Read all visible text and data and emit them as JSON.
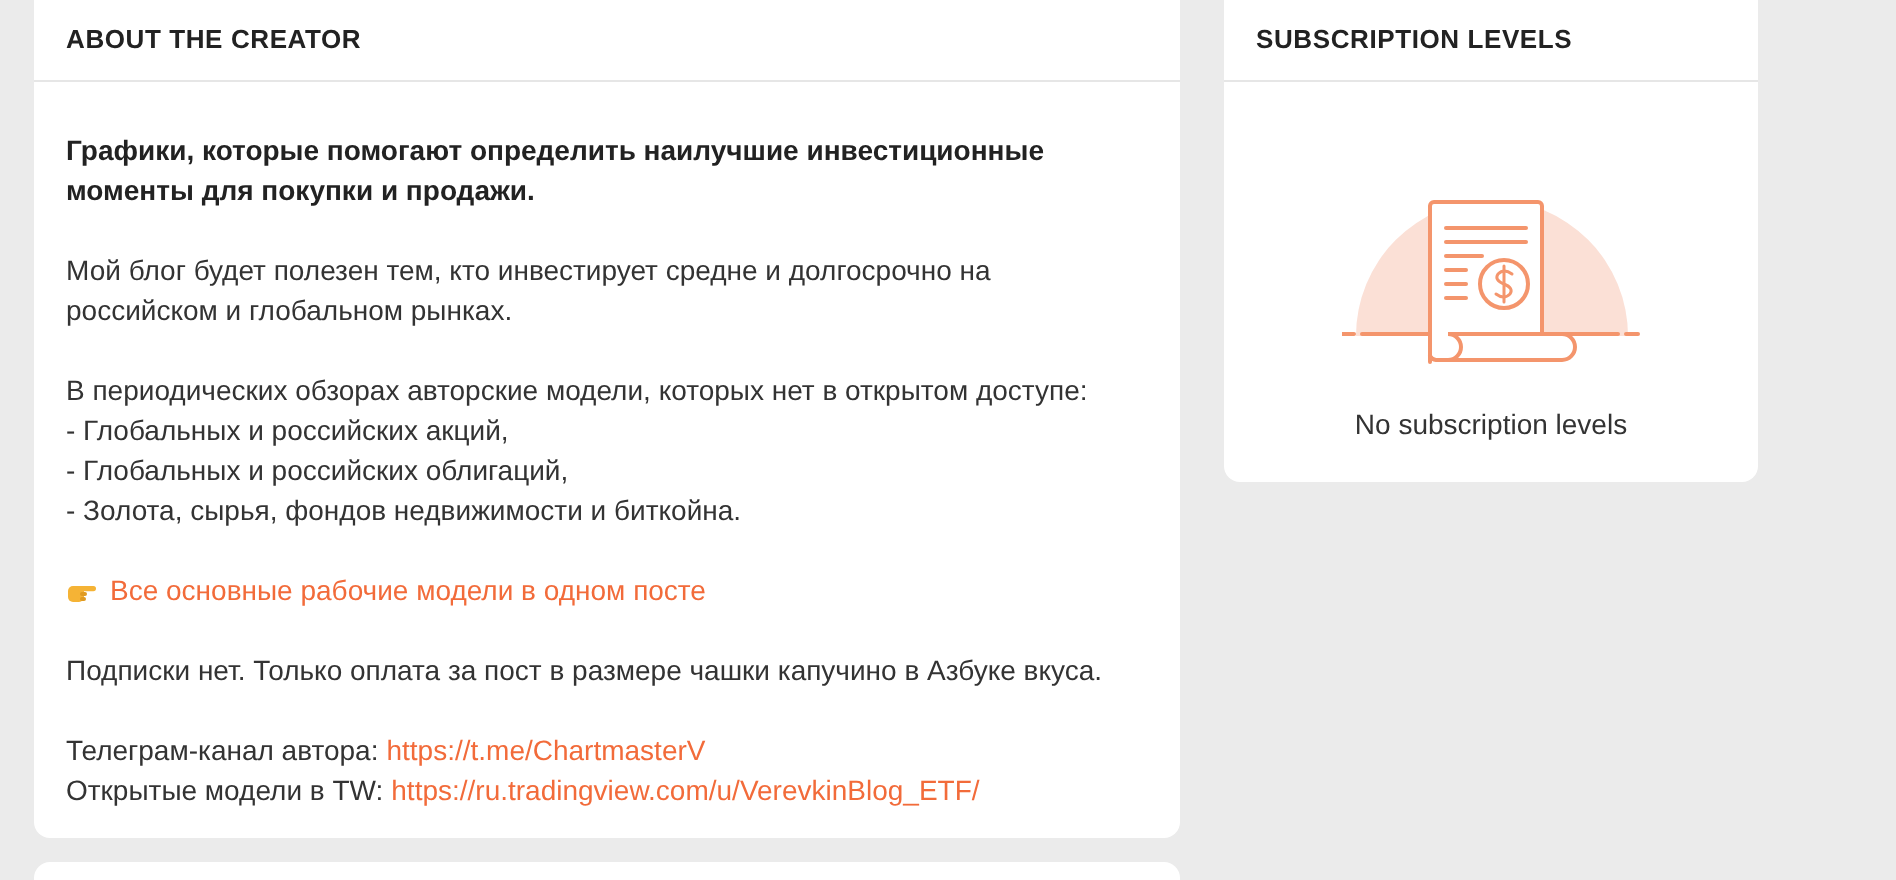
{
  "about": {
    "title": "ABOUT THE CREATOR",
    "blocks": [
      {
        "kind": "bold",
        "text": "Графики, которые помогают определить наилучшие инвестиционные моменты для покупки и продажи."
      },
      {
        "kind": "text",
        "text": "Мой блог будет полезен тем, кто инвестирует средне и долгосрочно на российском и глобальном рынках."
      },
      {
        "kind": "text",
        "text": "В периодических обзорах авторские модели, которых нет в открытом доступе:\n- Глобальных и российских акций,\n- Глобальных и российских облигаций,\n- Золота, сырья, фондов недвижимости и биткойна."
      },
      {
        "kind": "link",
        "text": "Все основные рабочие модели в одном посте"
      },
      {
        "kind": "text",
        "text": "Подписки нет. Только оплата за пост в размере чашки капучино в Азбуке вкуса."
      },
      {
        "kind": "labeled_links",
        "lines": [
          {
            "label": "Телеграм-канал автора:",
            "url": "https://t.me/ChartmasterV"
          },
          {
            "label": "Открытые модели в TW:",
            "url": "https://ru.tradingview.com/u/VerevkinBlog_ETF/"
          }
        ]
      }
    ]
  },
  "subscriptions": {
    "title": "SUBSCRIPTION LEVELS",
    "empty_text": "No subscription levels"
  }
}
